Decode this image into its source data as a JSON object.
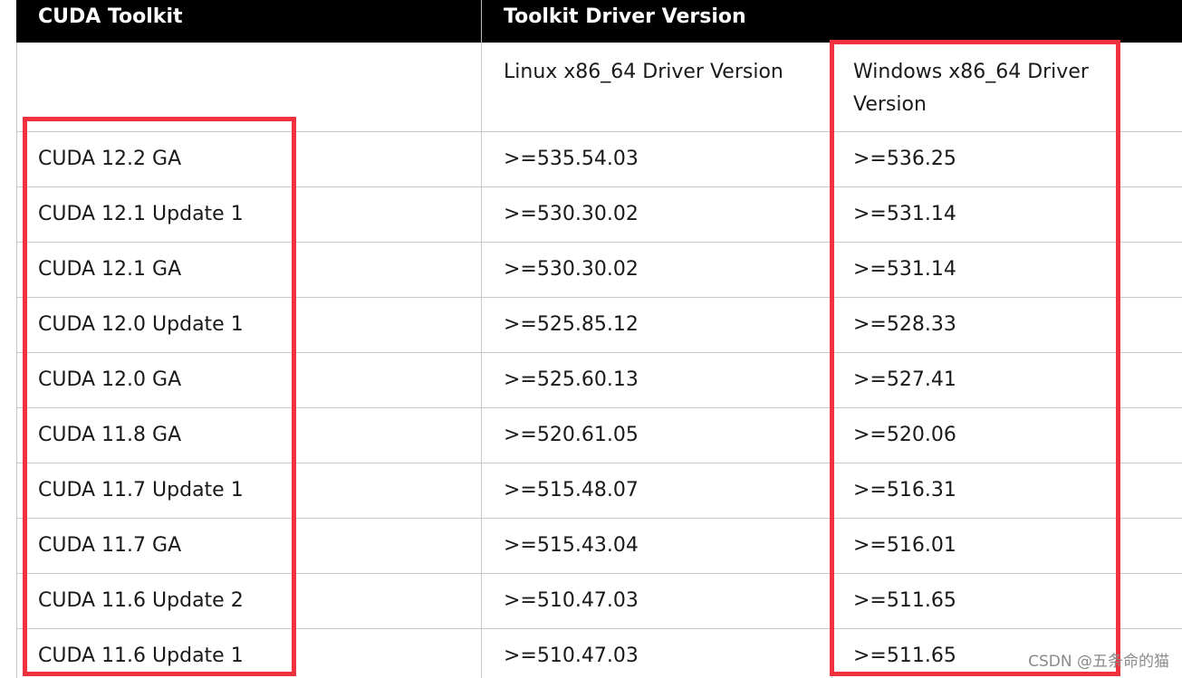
{
  "header": {
    "col1": "CUDA Toolkit",
    "col2": "Toolkit Driver Version"
  },
  "subheader": {
    "col1": "",
    "col2": "Linux x86_64 Driver Version",
    "col3_line1": "Windows x86_64 Driver",
    "col3_line2": "Version"
  },
  "rows": [
    {
      "toolkit": "CUDA 12.2 GA",
      "linux": ">=535.54.03",
      "windows": ">=536.25"
    },
    {
      "toolkit": "CUDA 12.1 Update 1",
      "linux": ">=530.30.02",
      "windows": ">=531.14"
    },
    {
      "toolkit": "CUDA 12.1 GA",
      "linux": ">=530.30.02",
      "windows": ">=531.14"
    },
    {
      "toolkit": "CUDA 12.0 Update 1",
      "linux": ">=525.85.12",
      "windows": ">=528.33"
    },
    {
      "toolkit": "CUDA 12.0 GA",
      "linux": ">=525.60.13",
      "windows": ">=527.41"
    },
    {
      "toolkit": "CUDA 11.8 GA",
      "linux": ">=520.61.05",
      "windows": ">=520.06"
    },
    {
      "toolkit": "CUDA 11.7 Update 1",
      "linux": ">=515.48.07",
      "windows": ">=516.31"
    },
    {
      "toolkit": "CUDA 11.7 GA",
      "linux": ">=515.43.04",
      "windows": ">=516.01"
    },
    {
      "toolkit": "CUDA 11.6 Update 2",
      "linux": ">=510.47.03",
      "windows": ">=511.65"
    },
    {
      "toolkit": "CUDA 11.6 Update 1",
      "linux": ">=510.47.03",
      "windows": ">=511.65"
    }
  ],
  "watermark": "CSDN @五条命的猫",
  "colors": {
    "header_bg": "#000000",
    "highlight_border": "#f0323f",
    "grid_line": "#c8c8c8"
  }
}
